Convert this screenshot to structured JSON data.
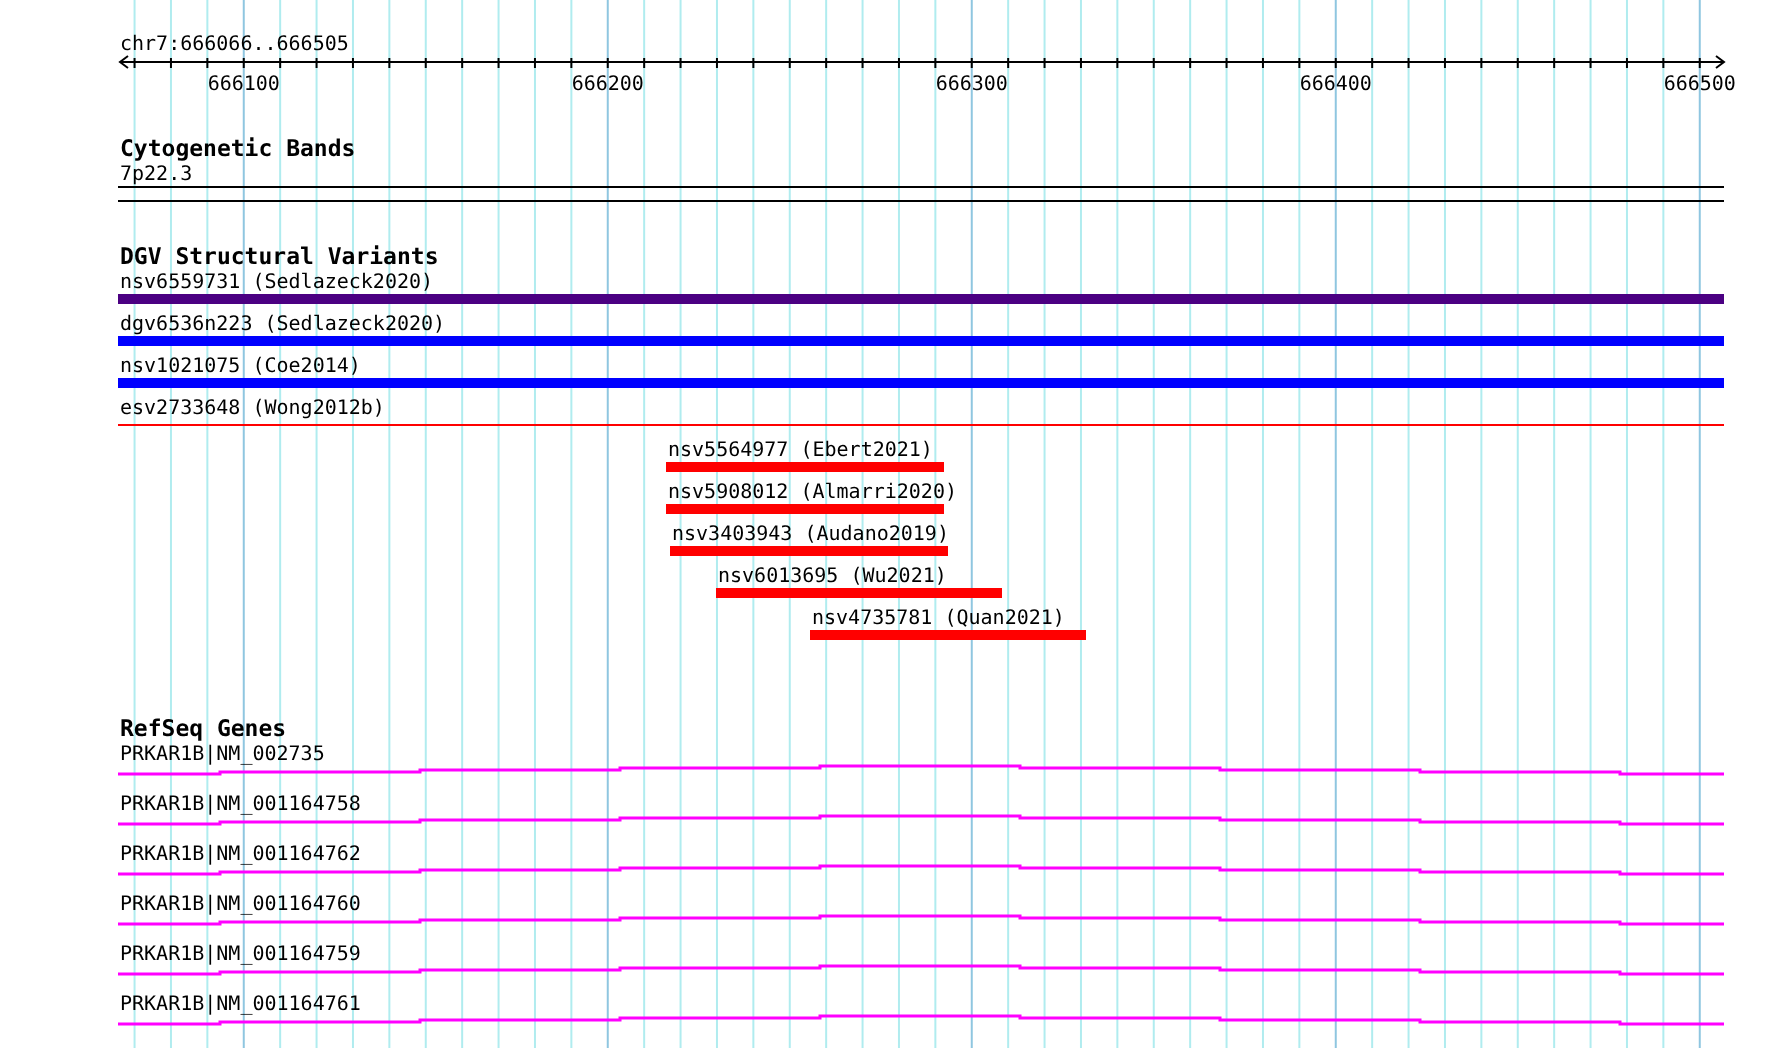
{
  "ruler": {
    "range_label": "chr7:666066..666505",
    "tick_labels": [
      "666100",
      "666200",
      "666300",
      "666400",
      "666500"
    ]
  },
  "tracks": [
    {
      "kind": "bands",
      "title": "Cytogenetic Bands",
      "features": [
        {
          "label": "7p22.3"
        }
      ]
    },
    {
      "kind": "variants",
      "title": "DGV Structural Variants",
      "features": [
        {
          "label": "nsv6559731 (Sedlazeck2020)",
          "color": "#4b0082"
        },
        {
          "label": "dgv6536n223 (Sedlazeck2020)",
          "color": "#0000ff"
        },
        {
          "label": "nsv1021075 (Coe2014)",
          "color": "#0000ff"
        },
        {
          "label": "esv2733648 (Wong2012b)",
          "color": "#ff0000"
        },
        {
          "label": "nsv5564977 (Ebert2021)",
          "color": "#ff0000"
        },
        {
          "label": "nsv5908012 (Almarri2020)",
          "color": "#ff0000"
        },
        {
          "label": "nsv3403943 (Audano2019)",
          "color": "#ff0000"
        },
        {
          "label": "nsv6013695 (Wu2021)",
          "color": "#ff0000"
        },
        {
          "label": "nsv4735781 (Quan2021)",
          "color": "#ff0000"
        }
      ]
    },
    {
      "kind": "genes",
      "title": "RefSeq Genes",
      "features": [
        {
          "label": "PRKAR1B|NM_002735"
        },
        {
          "label": "PRKAR1B|NM_001164758"
        },
        {
          "label": "PRKAR1B|NM_001164762"
        },
        {
          "label": "PRKAR1B|NM_001164760"
        },
        {
          "label": "PRKAR1B|NM_001164759"
        },
        {
          "label": "PRKAR1B|NM_001164761"
        }
      ]
    }
  ]
}
